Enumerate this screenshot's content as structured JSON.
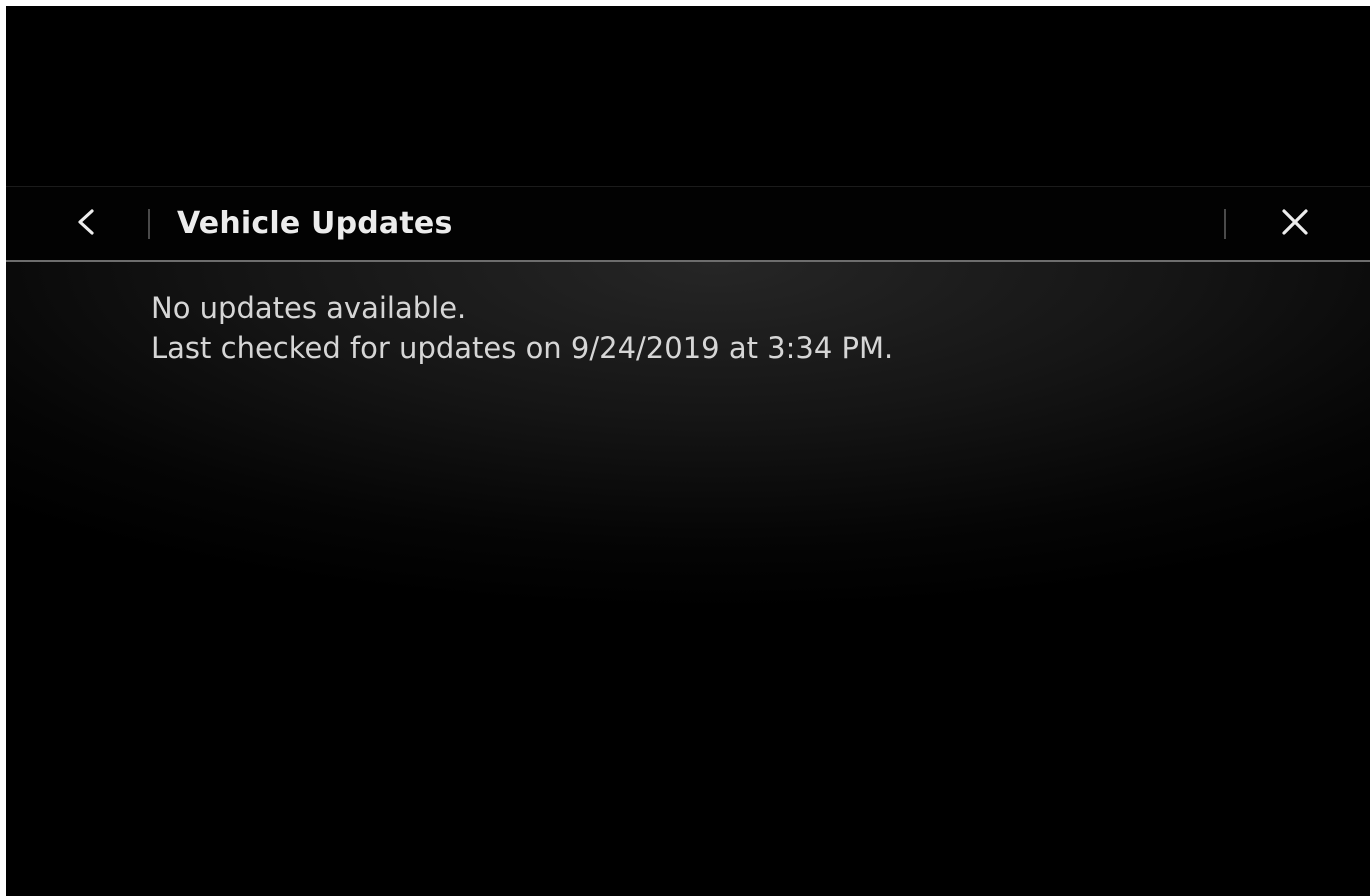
{
  "header": {
    "title": "Vehicle Updates",
    "back_icon": "chevron-left-icon",
    "close_icon": "close-icon"
  },
  "content": {
    "status_line": "No updates available.",
    "last_checked_line": "Last checked for updates on 9/24/2019 at 3:34 PM."
  },
  "colors": {
    "background": "#000000",
    "text": "#d6d6d6",
    "title": "#ececec",
    "header_rule": "#6d6d6d"
  }
}
